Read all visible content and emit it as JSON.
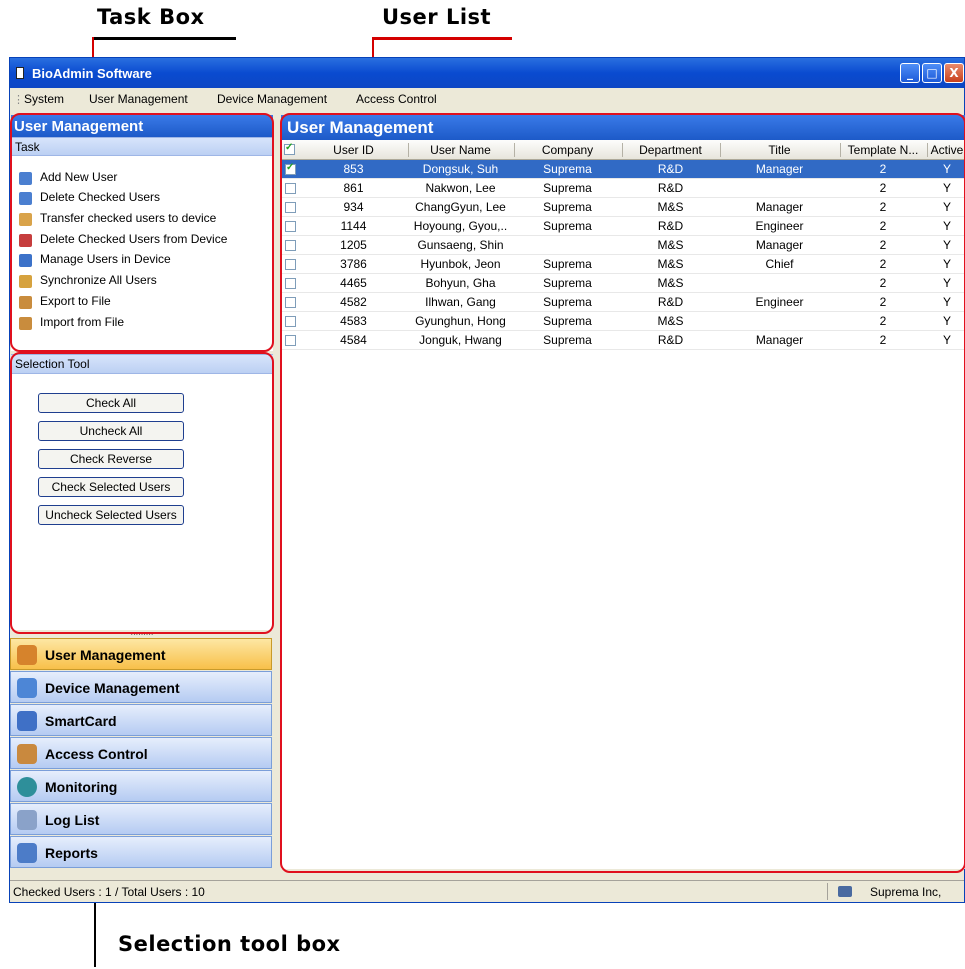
{
  "callouts": {
    "task_box": "Task Box",
    "user_list": "User List",
    "selection_tool_box": "Selection tool box"
  },
  "window": {
    "title": "BioAdmin Software",
    "min": "_",
    "max": "□",
    "close": "X"
  },
  "menu": [
    "System",
    "User Management",
    "Device Management",
    "Access Control"
  ],
  "left_panel": {
    "header": "User Management",
    "task_label": "Task",
    "tasks": [
      {
        "label": "Add New User",
        "icon": "add-user-icon"
      },
      {
        "label": "Delete Checked Users",
        "icon": "delete-user-icon"
      },
      {
        "label": "Transfer checked users to device",
        "icon": "transfer-icon"
      },
      {
        "label": "Delete Checked Users from Device",
        "icon": "delete-device-user-icon"
      },
      {
        "label": "Manage Users in Device",
        "icon": "manage-device-icon"
      },
      {
        "label": "Synchronize All Users",
        "icon": "sync-icon"
      },
      {
        "label": "Export to File",
        "icon": "export-icon"
      },
      {
        "label": "Import from File",
        "icon": "import-icon"
      }
    ],
    "selection_label": "Selection Tool",
    "selection_buttons": [
      "Check All",
      "Uncheck All",
      "Check Reverse",
      "Check Selected Users",
      "Uncheck Selected Users"
    ],
    "splitter": "........."
  },
  "nav": [
    {
      "label": "User Management",
      "icon": "user-management-icon",
      "active": true
    },
    {
      "label": "Device Management",
      "icon": "device-management-icon",
      "active": false
    },
    {
      "label": "SmartCard",
      "icon": "smartcard-icon",
      "active": false
    },
    {
      "label": "Access Control",
      "icon": "access-control-icon",
      "active": false
    },
    {
      "label": "Monitoring",
      "icon": "monitoring-icon",
      "active": false
    },
    {
      "label": "Log List",
      "icon": "log-list-icon",
      "active": false
    },
    {
      "label": "Reports",
      "icon": "reports-icon",
      "active": false
    }
  ],
  "right_panel": {
    "header": "User Management"
  },
  "table": {
    "columns": [
      "User ID",
      "User Name",
      "Company",
      "Department",
      "Title",
      "Template N...",
      "Active"
    ],
    "rows": [
      {
        "checked": true,
        "selected": true,
        "cells": [
          "853",
          "Dongsuk, Suh",
          "Suprema",
          "R&D",
          "Manager",
          "2",
          "Y"
        ]
      },
      {
        "checked": false,
        "selected": false,
        "cells": [
          "861",
          "Nakwon, Lee",
          "Suprema",
          "R&D",
          "",
          "2",
          "Y"
        ]
      },
      {
        "checked": false,
        "selected": false,
        "cells": [
          "934",
          "ChangGyun, Lee",
          "Suprema",
          "M&S",
          "Manager",
          "2",
          "Y"
        ]
      },
      {
        "checked": false,
        "selected": false,
        "cells": [
          "1144",
          "Hoyoung, Gyou,..",
          "Suprema",
          "R&D",
          "Engineer",
          "2",
          "Y"
        ]
      },
      {
        "checked": false,
        "selected": false,
        "cells": [
          "1205",
          "Gunsaeng, Shin",
          "",
          "M&S",
          "Manager",
          "2",
          "Y"
        ]
      },
      {
        "checked": false,
        "selected": false,
        "cells": [
          "3786",
          "Hyunbok, Jeon",
          "Suprema",
          "M&S",
          "Chief",
          "2",
          "Y"
        ]
      },
      {
        "checked": false,
        "selected": false,
        "cells": [
          "4465",
          "Bohyun, Gha",
          "Suprema",
          "M&S",
          "",
          "2",
          "Y"
        ]
      },
      {
        "checked": false,
        "selected": false,
        "cells": [
          "4582",
          "Ilhwan, Gang",
          "Suprema",
          "R&D",
          "Engineer",
          "2",
          "Y"
        ]
      },
      {
        "checked": false,
        "selected": false,
        "cells": [
          "4583",
          "Gyunghun, Hong",
          "Suprema",
          "M&S",
          "",
          "2",
          "Y"
        ]
      },
      {
        "checked": false,
        "selected": false,
        "cells": [
          "4584",
          "Jonguk, Hwang",
          "Suprema",
          "R&D",
          "Manager",
          "2",
          "Y"
        ]
      }
    ]
  },
  "status": {
    "text": "Checked Users : 1 / Total Users : 10",
    "company": "Suprema Inc,"
  },
  "colors": {
    "accent": "#1d5ac8",
    "highlight": "#e0101e",
    "selected_row": "#316ac5",
    "active_nav": "#f8c04a"
  }
}
